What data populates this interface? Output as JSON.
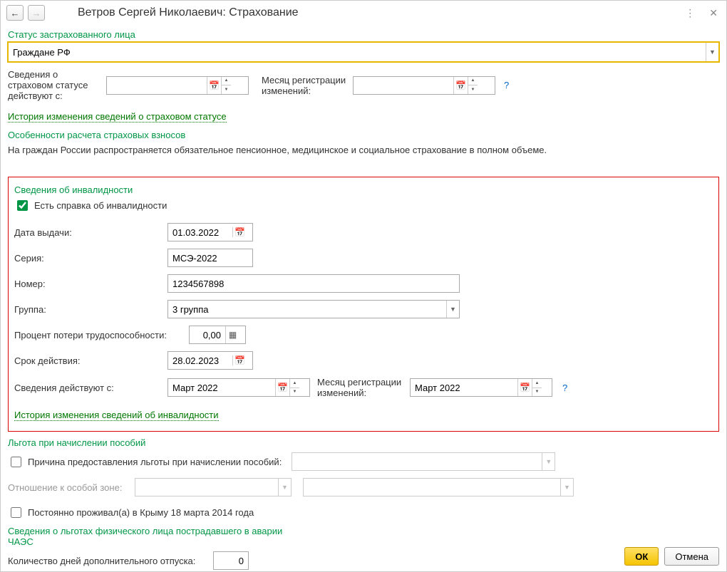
{
  "titlebar": {
    "title": "Ветров Сергей Николаевич: Страхование"
  },
  "status": {
    "label": "Статус застрахованного лица",
    "value": "Граждане РФ",
    "effective_from_label": "Сведения о страховом статусе действуют с:",
    "effective_from_value": "",
    "reg_month_label": "Месяц регистрации изменений:",
    "reg_month_value": "",
    "history_link": "История изменения сведений о страховом статусе",
    "calc_title": "Особенности расчета страховых взносов",
    "calc_desc": "На граждан России распространяется обязательное пенсионное, медицинское и социальное страхование в полном объеме."
  },
  "disability": {
    "title": "Сведения об инвалидности",
    "checkbox_label": "Есть справка об инвалидности",
    "checkbox_checked": true,
    "issue_date_label": "Дата выдачи:",
    "issue_date": "01.03.2022",
    "series_label": "Серия:",
    "series": "МСЭ-2022",
    "number_label": "Номер:",
    "number": "1234567898",
    "group_label": "Группа:",
    "group": "3 группа",
    "percent_label": "Процент потери трудоспособности:",
    "percent": "0,00",
    "valid_until_label": "Срок действия:",
    "valid_until": "28.02.2023",
    "effective_from_label": "Сведения действуют с:",
    "effective_from": "Март 2022",
    "reg_month_label": "Месяц регистрации изменений:",
    "reg_month": "Март 2022",
    "history_link": "История изменения сведений об инвалидности"
  },
  "benefit": {
    "title": "Льгота при начислении пособий",
    "reason_label": "Причина предоставления льготы при начислении пособий:",
    "reason_value": "",
    "zone_label": "Отношение к особой зоне:",
    "crimea_label": "Постоянно проживал(а) в Крыму 18 марта 2014 года",
    "chaes_title": "Сведения о льготах физического лица пострадавшего в аварии ЧАЭС",
    "vacation_label": "Количество дней дополнительного отпуска:",
    "vacation_days": "0"
  },
  "buttons": {
    "ok": "ОК",
    "cancel": "Отмена"
  }
}
